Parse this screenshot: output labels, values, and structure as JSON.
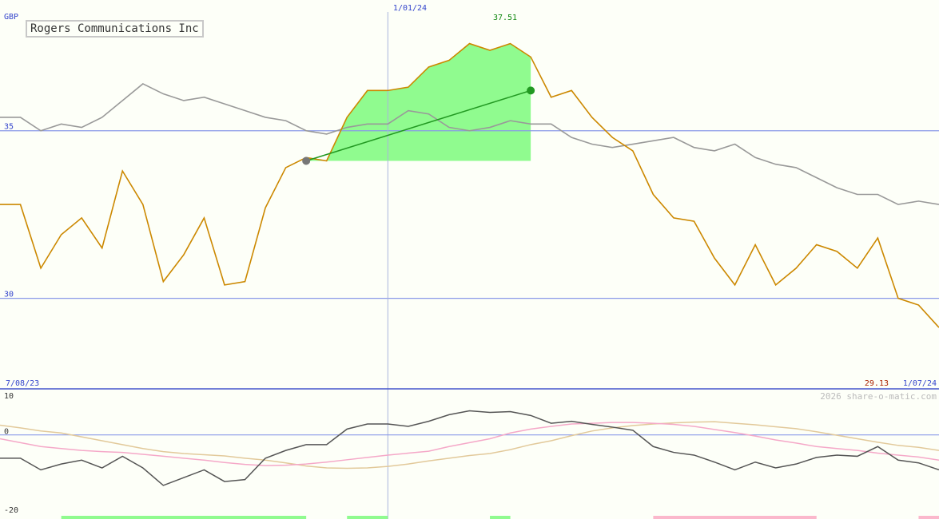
{
  "header": {
    "currency": "GBP",
    "title": "Rogers Communications Inc",
    "marker_date": "1/01/24",
    "peak_label": "37.51"
  },
  "footer": {
    "start_date": "7/08/23",
    "end_date": "1/07/24",
    "last_price": "29.13",
    "credit": "2026 share-o-matic.com"
  },
  "colors": {
    "background": "#fdfff8",
    "price_line": "#cc8800",
    "index_line": "#999999",
    "highlight_fill": "#90fb8f",
    "trend_line": "#229922",
    "grid_line": "#8a99e8",
    "osc_black": "#555555",
    "osc_pink": "#f5a8c8",
    "osc_tan": "#e2c99a",
    "vol_green": "#90fb8f",
    "vol_pink": "#fbb8cc"
  },
  "chart_data": [
    {
      "type": "line",
      "ylabel": "GBP",
      "ylim": [
        27.3,
        38.9
      ],
      "yticks": [
        "35",
        "30"
      ],
      "x": [
        "7/08/23",
        "",
        "",
        "",
        "",
        "",
        "",
        "",
        "",
        "",
        "",
        "",
        "",
        "",
        "",
        "",
        "",
        "",
        "",
        "1/01/24",
        "",
        "",
        "",
        "",
        "",
        "",
        "",
        "",
        "",
        "",
        "",
        "",
        "",
        "",
        "",
        "",
        "",
        "",
        "",
        "",
        "",
        "",
        "",
        "",
        "",
        "1/07/24"
      ],
      "series": [
        {
          "name": "Rogers Communications Inc",
          "values": [
            32.8,
            32.8,
            30.9,
            31.9,
            32.4,
            31.5,
            33.8,
            32.8,
            30.5,
            31.3,
            32.4,
            30.4,
            30.5,
            32.7,
            33.9,
            34.2,
            34.1,
            35.4,
            36.2,
            36.2,
            36.3,
            36.9,
            37.1,
            37.6,
            37.4,
            37.6,
            37.2,
            36.0,
            36.2,
            35.4,
            34.8,
            34.4,
            33.1,
            32.4,
            32.3,
            31.2,
            30.4,
            31.6,
            30.4,
            30.9,
            31.6,
            31.4,
            30.9,
            31.8,
            30.0,
            29.8,
            29.13
          ]
        },
        {
          "name": "",
          "values": [
            35.4,
            35.4,
            35.0,
            35.2,
            35.1,
            35.4,
            35.9,
            36.4,
            36.1,
            35.9,
            36.0,
            35.8,
            35.6,
            35.4,
            35.3,
            35.0,
            34.9,
            35.1,
            35.2,
            35.2,
            35.6,
            35.5,
            35.1,
            35.0,
            35.1,
            35.3,
            35.2,
            35.2,
            34.8,
            34.6,
            34.5,
            34.6,
            34.7,
            34.8,
            34.5,
            34.4,
            34.6,
            34.2,
            34.0,
            33.9,
            33.6,
            33.3,
            33.1,
            33.1,
            32.8,
            32.9,
            32.8
          ]
        }
      ],
      "highlight": {
        "from_index": 15,
        "to_index": 26,
        "start_value": 34.1,
        "end_value": 36.2,
        "peak_value": 37.51
      }
    },
    {
      "type": "line",
      "ylim": [
        -20,
        10
      ],
      "yticks": [
        "10",
        "0",
        "-20"
      ],
      "series": [
        {
          "name": "",
          "values": [
            -6,
            -6,
            -9,
            -7.5,
            -6.5,
            -8.5,
            -5.5,
            -8.5,
            -13,
            -11,
            -9,
            -12,
            -11.5,
            -6,
            -4,
            -2.5,
            -2.5,
            1.5,
            2.8,
            2.8,
            2.2,
            3.5,
            5.2,
            6.2,
            5.8,
            6,
            5,
            3,
            3.5,
            2.7,
            2,
            1.2,
            -3,
            -4.5,
            -5.2,
            -7,
            -9,
            -7,
            -8.5,
            -7.5,
            -5.8,
            -5.2,
            -5.5,
            -3,
            -6.5,
            -7.2,
            -9
          ]
        },
        {
          "name": "",
          "values": [
            -1,
            -2,
            -3,
            -3.5,
            -4,
            -4.3,
            -4.5,
            -5,
            -5.5,
            -6,
            -6.5,
            -7.1,
            -7.6,
            -7.9,
            -7.8,
            -7.5,
            -7,
            -6.4,
            -5.8,
            -5.2,
            -4.7,
            -4.2,
            -3,
            -2,
            -1,
            0.5,
            1.5,
            2.2,
            2.8,
            3,
            3.2,
            3.2,
            3,
            2.7,
            2.2,
            1.4,
            0.6,
            -0.3,
            -1.3,
            -2.1,
            -3,
            -3.5,
            -4,
            -4.7,
            -5.2,
            -5.7,
            -6.5
          ]
        },
        {
          "name": "",
          "values": [
            2.5,
            1.8,
            1,
            0.5,
            -0.5,
            -1.5,
            -2.5,
            -3.5,
            -4.3,
            -4.8,
            -5.1,
            -5.4,
            -6,
            -6.5,
            -7.2,
            -8,
            -8.5,
            -8.6,
            -8.5,
            -8.1,
            -7.5,
            -6.7,
            -6,
            -5.3,
            -4.8,
            -3.8,
            -2.5,
            -1.5,
            -0.2,
            1,
            1.8,
            2.4,
            2.8,
            3.1,
            3.3,
            3.4,
            3,
            2.6,
            2.1,
            1.6,
            0.8,
            -0.1,
            -1,
            -1.9,
            -2.7,
            -3.2,
            -4
          ]
        }
      ]
    },
    {
      "type": "bar",
      "series": [
        {
          "name": "",
          "values": [
            0,
            0,
            0,
            0,
            0,
            0,
            0,
            0,
            0,
            0,
            0,
            0,
            0,
            0,
            0,
            0,
            0,
            0,
            0,
            0,
            0,
            0,
            0,
            0,
            0,
            0,
            0,
            0,
            0,
            0,
            0,
            0,
            0,
            0,
            0,
            0,
            0,
            0,
            0,
            0,
            0,
            0,
            0,
            0,
            0,
            0,
            0
          ],
          "green_ranges": [
            [
              3,
              15
            ],
            [
              17,
              19
            ],
            [
              24,
              25
            ]
          ],
          "pink_ranges": [
            [
              32,
              40
            ],
            [
              45,
              46
            ]
          ]
        }
      ]
    }
  ]
}
